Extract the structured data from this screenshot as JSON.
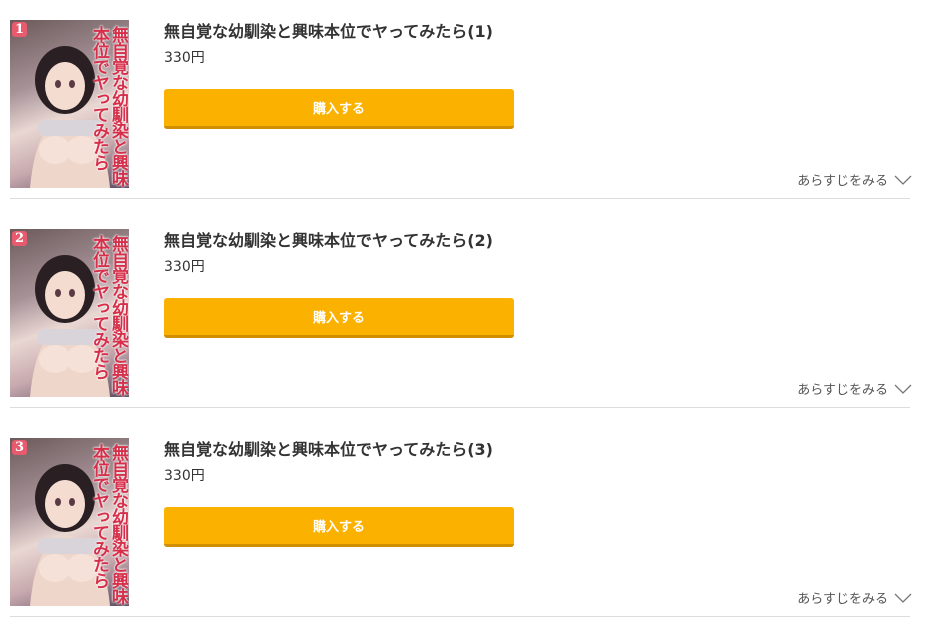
{
  "items": [
    {
      "title": "無自覚な幼馴染と興味本位でヤってみたら(1)",
      "price": "330円",
      "buy_label": "購入する",
      "synopsis_label": "あらすじをみる",
      "cover": {
        "volume": "1",
        "title_text": "無自覚な幼馴染と興味本位でヤってみたら"
      }
    },
    {
      "title": "無自覚な幼馴染と興味本位でヤってみたら(2)",
      "price": "330円",
      "buy_label": "購入する",
      "synopsis_label": "あらすじをみる",
      "cover": {
        "volume": "2",
        "title_text": "無自覚な幼馴染と興味本位でヤってみたら"
      }
    },
    {
      "title": "無自覚な幼馴染と興味本位でヤってみたら(3)",
      "price": "330円",
      "buy_label": "購入する",
      "synopsis_label": "あらすじをみる",
      "cover": {
        "volume": "3",
        "title_text": "無自覚な幼馴染と興味本位でヤってみたら"
      }
    }
  ],
  "icons": {
    "expand": "chevron-down-icon"
  },
  "colors": {
    "buy_button": "#fbb100",
    "buy_button_shadow": "#d08f00",
    "separator": "#dcdcdc",
    "cover_title": "#d62f4a"
  }
}
